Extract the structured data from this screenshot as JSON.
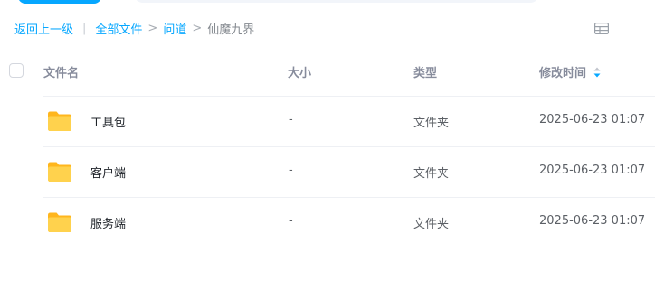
{
  "breadcrumb": {
    "back": "返回上一级",
    "separator_pipe": "|",
    "separator": ">",
    "items": [
      "全部文件",
      "问道",
      "仙魔九界"
    ]
  },
  "table": {
    "columns": {
      "name": "文件名",
      "size": "大小",
      "type": "类型",
      "mtime": "修改时间"
    },
    "rows": [
      {
        "name": "工具包",
        "size": "-",
        "type": "文件夹",
        "mtime": "2025-06-23 01:07"
      },
      {
        "name": "客户端",
        "size": "-",
        "type": "文件夹",
        "mtime": "2025-06-23 01:07"
      },
      {
        "name": "服务端",
        "size": "-",
        "type": "文件夹",
        "mtime": "2025-06-23 01:07"
      }
    ]
  },
  "colors": {
    "accent": "#06a7ff",
    "folder": "#ffc53d",
    "muted_text": "#878c9c"
  },
  "icons": {
    "view_toggle": "grid-view-icon",
    "sort": "sort-desc-icon",
    "row": "folder-icon"
  }
}
